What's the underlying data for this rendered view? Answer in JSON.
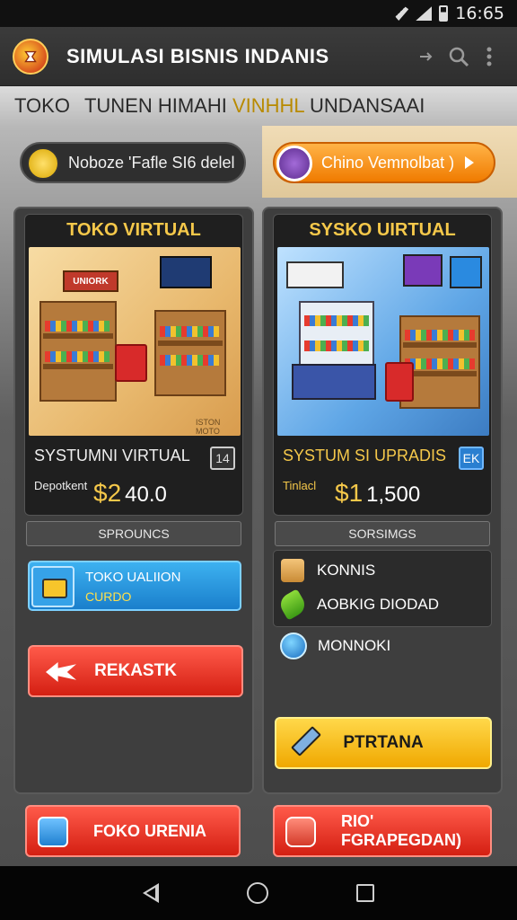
{
  "status_bar": {
    "time": "16:65"
  },
  "app_bar": {
    "title": "SIMULASI BISNIS INDANIS"
  },
  "ticker": {
    "part1": "TOKO",
    "part2": "TUNEN HIMAHI",
    "highlight": "VINHHL",
    "part3": "UNDANSAAI"
  },
  "pills": {
    "left_label": "Noboze 'Fafle SI6 delel",
    "right_label": "Chino Vemnolbat )"
  },
  "left_panel": {
    "card_title": "TOKO VIRTUAL",
    "sign_text": "UNIORK",
    "image_caption": "ISTON MOTO",
    "subtitle": "SYSTUMNI VIRTUAL",
    "badge": "14",
    "price_label": "Depotkent",
    "currency": "$2",
    "price": "40.0",
    "section": "SPROUNCS",
    "promo_line1": "TOKO UALIION",
    "promo_line2": "CURDO",
    "button_label": "REKASTK",
    "bottom_button": "FOKO URENIA"
  },
  "right_panel": {
    "card_title": "SYSKO UIRTUAL",
    "subtitle": "SYSTUM SI UPRADIS",
    "badge": "EK",
    "price_label": "Tinlacl",
    "currency": "$1",
    "price": "1,500",
    "section": "SORSIMGS",
    "items": [
      "KONNIS",
      "AOBKIG DIODAD"
    ],
    "extra_item": "MONNOKI",
    "button_label": "PTRTANA",
    "bottom_button": "RIO' FGRAPEGDAN)"
  },
  "colors": {
    "accent_gold": "#f5c84a",
    "button_red": "#d41f12",
    "button_yellow": "#f0a800",
    "orange_pill": "#f07b00"
  }
}
